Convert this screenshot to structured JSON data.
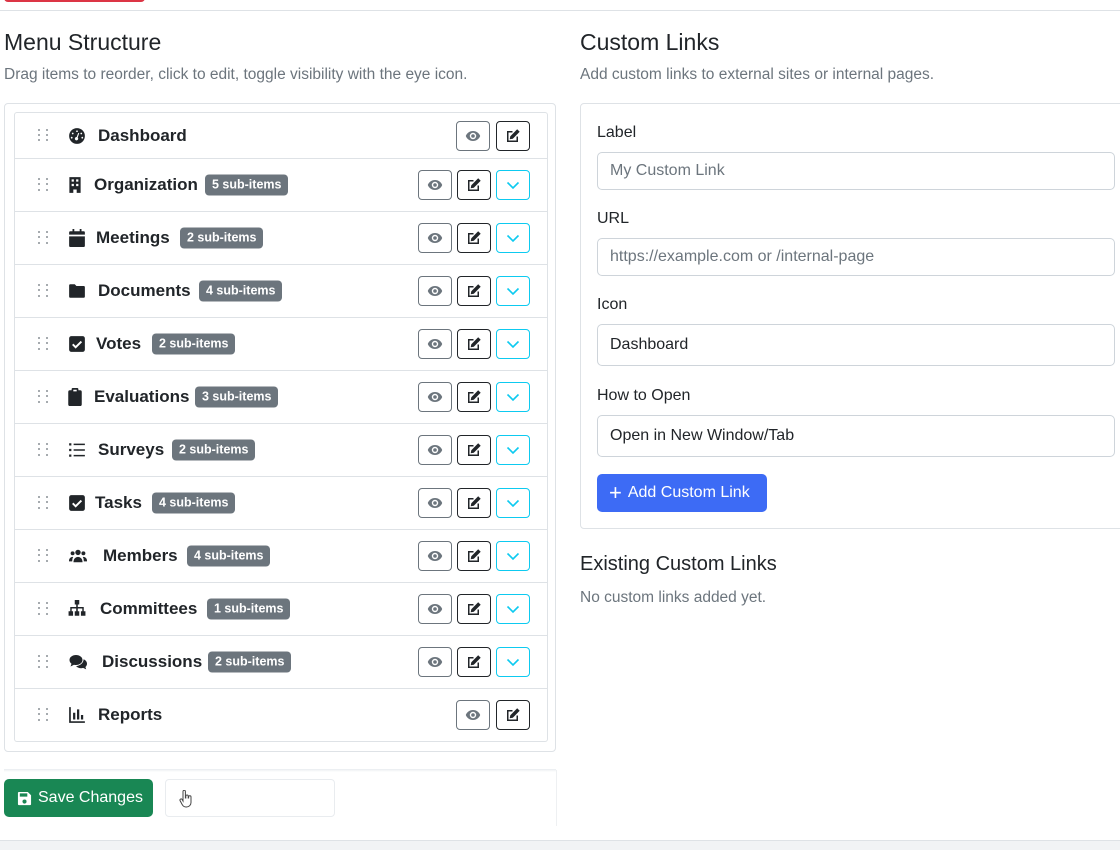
{
  "menu_structure": {
    "title": "Menu Structure",
    "subtitle": "Drag items to reorder, click to edit, toggle visibility with the eye icon.",
    "items": [
      {
        "label": "Dashboard",
        "icon": "dashboard-icon",
        "badge": "",
        "expandable": false
      },
      {
        "label": "Organization",
        "icon": "building-icon",
        "badge": "5 sub-items",
        "expandable": true
      },
      {
        "label": "Meetings",
        "icon": "calendar-icon",
        "badge": "2 sub-items",
        "expandable": true
      },
      {
        "label": "Documents",
        "icon": "folder-icon",
        "badge": "4 sub-items",
        "expandable": true
      },
      {
        "label": "Votes",
        "icon": "check-square-icon",
        "badge": "2 sub-items",
        "expandable": true
      },
      {
        "label": "Evaluations",
        "icon": "clipboard-icon",
        "badge": "3 sub-items",
        "expandable": true
      },
      {
        "label": "Surveys",
        "icon": "list-icon",
        "badge": "2 sub-items",
        "expandable": true
      },
      {
        "label": "Tasks",
        "icon": "check-square-icon",
        "badge": "4 sub-items",
        "expandable": true
      },
      {
        "label": "Members",
        "icon": "users-icon",
        "badge": "4 sub-items",
        "expandable": true
      },
      {
        "label": "Committees",
        "icon": "sitemap-icon",
        "badge": "1 sub-items",
        "expandable": true
      },
      {
        "label": "Discussions",
        "icon": "comments-icon",
        "badge": "2 sub-items",
        "expandable": true
      },
      {
        "label": "Reports",
        "icon": "chart-icon",
        "badge": "",
        "expandable": false
      }
    ],
    "save_label": "Save Changes"
  },
  "custom_links": {
    "title": "Custom Links",
    "subtitle": "Add custom links to external sites or internal pages.",
    "label_field": {
      "label": "Label",
      "placeholder": "My Custom Link"
    },
    "url_field": {
      "label": "URL",
      "placeholder": "https://example.com or /internal-page"
    },
    "icon_field": {
      "label": "Icon",
      "value": "Dashboard"
    },
    "open_field": {
      "label": "How to Open",
      "value": "Open in New Window/Tab"
    },
    "add_label": "Add Custom Link",
    "existing_title": "Existing Custom Links",
    "existing_empty": "No custom links added yet."
  },
  "colors": {
    "primary": "#3d6bf5",
    "success": "#198754",
    "secondary": "#6c757d",
    "info": "#0dcaf0",
    "danger": "#dc3545"
  }
}
